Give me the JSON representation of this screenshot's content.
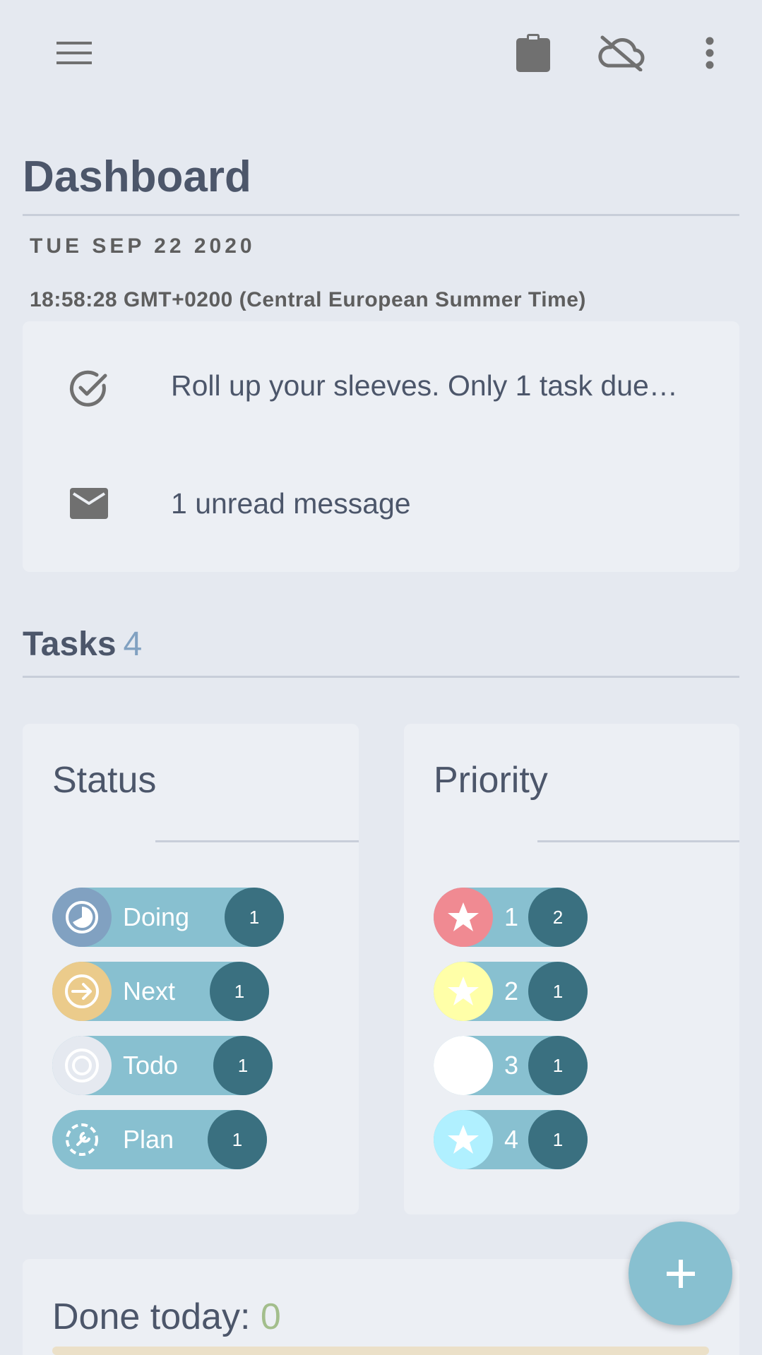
{
  "topbar": {
    "menu_icon": "menu-icon",
    "clipboard_icon": "clipboard-icon",
    "cloud_off_icon": "cloud-off-icon",
    "more_icon": "more-vert-icon"
  },
  "dashboard": {
    "title": "Dashboard",
    "date": "TUE SEP 22 2020",
    "time": "18:58:28 GMT+0200 (Central European Summer Time)"
  },
  "info": {
    "tasks_due": "Roll up your sleeves. Only 1 task due…",
    "messages": "1 unread message"
  },
  "tasks": {
    "label": "Tasks",
    "count": "4",
    "status": {
      "title": "Status",
      "items": [
        {
          "label": "Doing",
          "count": "1",
          "icon": "doing-icon",
          "color": "#81a1c1"
        },
        {
          "label": "Next",
          "count": "1",
          "icon": "next-arrow-icon",
          "color": "#ebcb8b"
        },
        {
          "label": "Todo",
          "count": "1",
          "icon": "todo-target-icon",
          "color": "#e5e9f0"
        },
        {
          "label": "Plan",
          "count": "1",
          "icon": "plan-wrench-icon",
          "color": "#88c0d0"
        }
      ]
    },
    "priority": {
      "title": "Priority",
      "items": [
        {
          "label": "1",
          "count": "2",
          "icon": "star-icon",
          "color": "#f08a92"
        },
        {
          "label": "2",
          "count": "1",
          "icon": "star-icon",
          "color": "#ffffa8"
        },
        {
          "label": "3",
          "count": "1",
          "icon": "blank-circle",
          "color": "#ffffff"
        },
        {
          "label": "4",
          "count": "1",
          "icon": "star-icon",
          "color": "#b0f0ff"
        }
      ]
    }
  },
  "done_today": {
    "label": "Done today:",
    "count": "0"
  },
  "fab": {
    "icon": "plus-icon"
  },
  "colors": {
    "background": "#e5e9f0",
    "card": "#eceff4",
    "chip": "#88c0d0",
    "count_badge": "#3a7080",
    "text": "#4c566a"
  }
}
